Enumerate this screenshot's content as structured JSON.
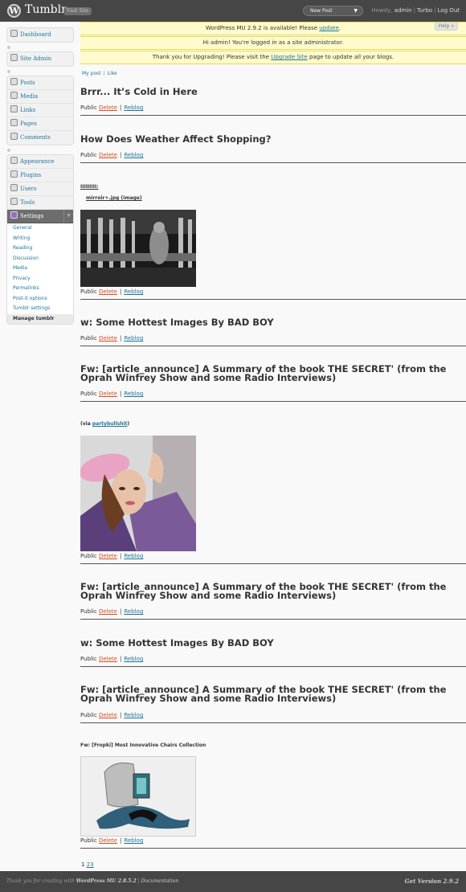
{
  "header": {
    "site_title": "Tumblr",
    "visit_site_label": "Visit Site",
    "new_post_label": "New Post",
    "howdy_label": "Howdy,",
    "user_name": "admin",
    "turbo_label": "Turbo",
    "logout_label": "Log Out"
  },
  "sidebar": {
    "dashboard": "Dashboard",
    "site_admin": "Site Admin",
    "posts": "Posts",
    "media": "Media",
    "links": "Links",
    "pages": "Pages",
    "comments": "Comments",
    "appearance": "Appearance",
    "plugins": "Plugins",
    "users": "Users",
    "tools": "Tools",
    "settings": "Settings",
    "settings_submenu": [
      "General",
      "Writing",
      "Reading",
      "Discussion",
      "Media",
      "Privacy",
      "Permalinks",
      "Post-it options",
      "Tumblr settings",
      "Manage tumblr"
    ]
  },
  "notices": {
    "update_text": "WordPress MU 2.9.2 is available! Please",
    "update_link": "update",
    "admin_text": "Hi admin! You're logged in as a site administrator.",
    "upgrade_before": "Thank you for Upgrading! Please visit the",
    "upgrade_link": "Upgrade Site",
    "upgrade_after": "page to update all your blogs.",
    "help_label": "Help »"
  },
  "content": {
    "my_post": "My post",
    "like": "Like",
    "public_label": "Public",
    "delete_label": "Delete",
    "reblog_label": "Reblog",
    "posts": [
      {
        "title": "Brrr... It’s Cold in Here"
      },
      {
        "title": "How Does Weather Affect Shopping?"
      },
      {
        "source_label": "IIIIIIIII:",
        "caption": "mirroir+.jpg (image)"
      },
      {
        "title": "w: Some Hottest Images By BAD BOY"
      },
      {
        "title": "Fw: [article_announce] A Summary of the book THE SECRET' (from the Oprah Winfrey Show and some Radio Interviews)"
      },
      {
        "via_label": "(via",
        "via_link": "partybullshit",
        "via_close": ")"
      },
      {
        "title": "Fw: [article_announce] A Summary of the book THE SECRET' (from the Oprah Winfrey Show and some Radio Interviews)"
      },
      {
        "title": "w: Some Hottest Images By BAD BOY"
      },
      {
        "title": "Fw: [article_announce] A Summary of the book THE SECRET' (from the Oprah Winfrey Show and some Radio Interviews)"
      },
      {
        "title": "Fw: [Fropki] Most Innovative Chairs Collection"
      }
    ],
    "pagination": {
      "current": "1",
      "next": "23"
    }
  },
  "footer": {
    "thanks_text": "Thank you for creating with",
    "wp_label": "WordPress MU 2.8.5.2",
    "sep": "|",
    "doc_label": "Documentation",
    "version_label": "Get Version 2.9.2"
  },
  "colors": {
    "header_bg": "#464646",
    "link": "#21759b",
    "delete": "#d54e21",
    "notice_bg": "#fffbcc"
  }
}
